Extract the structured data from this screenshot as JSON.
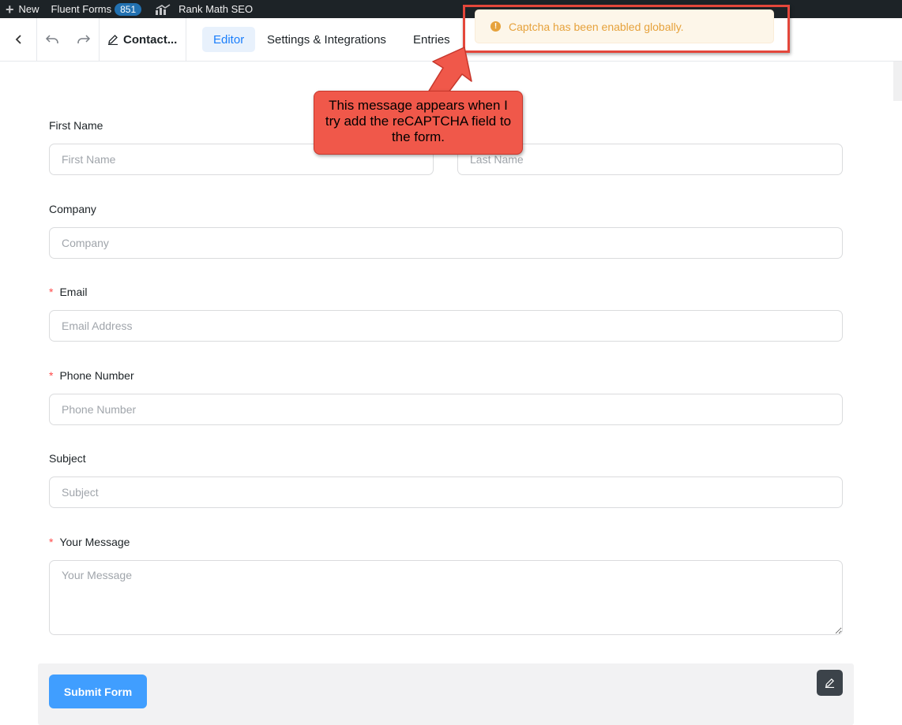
{
  "adminbar": {
    "new_label": "New",
    "fluent_forms_label": "Fluent Forms",
    "fluent_forms_count": "851",
    "rank_math_label": "Rank Math SEO"
  },
  "header": {
    "form_name": "Contact...",
    "tabs": [
      {
        "label": "Editor",
        "active": true
      },
      {
        "label": "Settings & Integrations",
        "active": false
      },
      {
        "label": "Entries",
        "active": false
      }
    ]
  },
  "form": {
    "first_name": {
      "label": "First Name",
      "placeholder": "First Name"
    },
    "last_name": {
      "placeholder": "Last Name"
    },
    "company": {
      "label": "Company",
      "placeholder": "Company"
    },
    "email": {
      "label": "Email",
      "placeholder": "Email Address",
      "required_mark": "*"
    },
    "phone": {
      "label": "Phone Number",
      "placeholder": "Phone Number",
      "required_mark": "*"
    },
    "subject": {
      "label": "Subject",
      "placeholder": "Subject"
    },
    "message": {
      "label": "Your Message",
      "placeholder": "Your Message",
      "required_mark": "*"
    },
    "submit_label": "Submit Form"
  },
  "toast": {
    "message": "Captcha has been enabled globally.",
    "icon": "!",
    "color": "#e6a23c"
  },
  "annotation": {
    "text": "This message appears when I try add the reCAPTCHA field to the form."
  },
  "colors": {
    "accent": "#1a7efb",
    "submit": "#409eff",
    "callout": "#f0584a"
  }
}
